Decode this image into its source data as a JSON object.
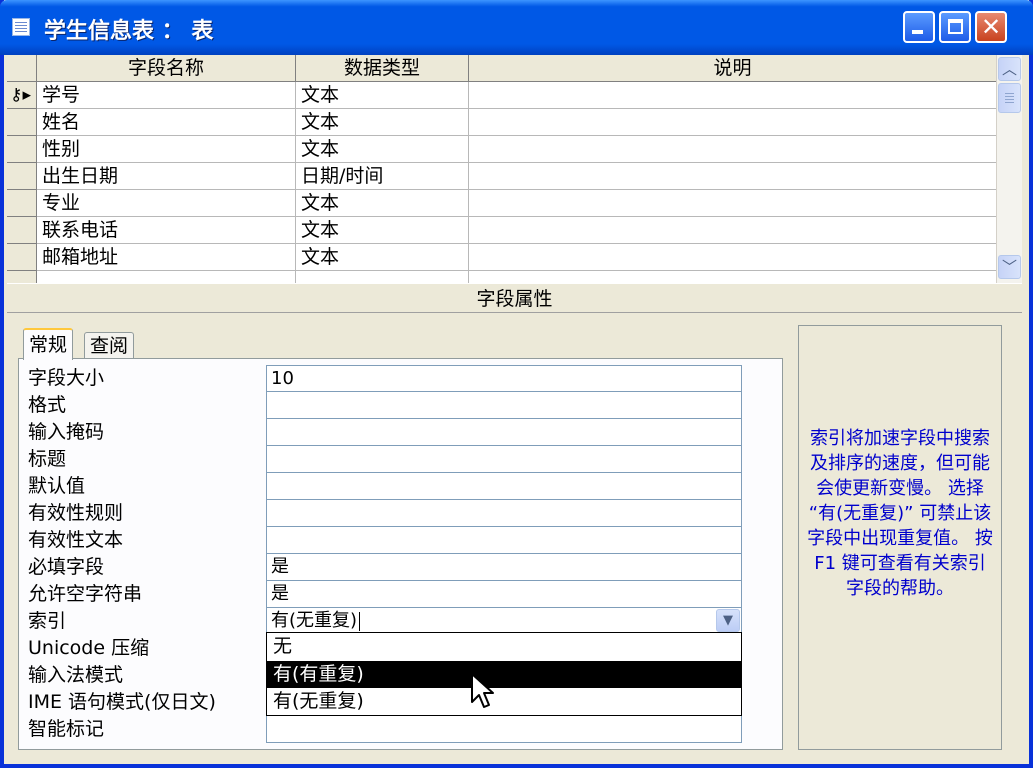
{
  "window": {
    "title": "学生信息表 ： 表"
  },
  "grid": {
    "headers": [
      "字段名称",
      "数据类型",
      "说明"
    ],
    "rows": [
      {
        "name": "学号",
        "type": "文本",
        "desc": ""
      },
      {
        "name": "姓名",
        "type": "文本",
        "desc": ""
      },
      {
        "name": "性别",
        "type": "文本",
        "desc": ""
      },
      {
        "name": "出生日期",
        "type": "日期/时间",
        "desc": ""
      },
      {
        "name": "专业",
        "type": "文本",
        "desc": ""
      },
      {
        "name": "联系电话",
        "type": "文本",
        "desc": ""
      },
      {
        "name": "邮箱地址",
        "type": "文本",
        "desc": ""
      }
    ]
  },
  "section_label": "字段属性",
  "tabs": {
    "general": "常规",
    "lookup": "查阅"
  },
  "properties": [
    {
      "label": "字段大小",
      "value": "10"
    },
    {
      "label": "格式",
      "value": ""
    },
    {
      "label": "输入掩码",
      "value": ""
    },
    {
      "label": "标题",
      "value": ""
    },
    {
      "label": "默认值",
      "value": ""
    },
    {
      "label": "有效性规则",
      "value": ""
    },
    {
      "label": "有效性文本",
      "value": ""
    },
    {
      "label": "必填字段",
      "value": "是"
    },
    {
      "label": "允许空字符串",
      "value": "是"
    },
    {
      "label": "索引",
      "value": "有(无重复)"
    },
    {
      "label": "Unicode 压缩",
      "value": ""
    },
    {
      "label": "输入法模式",
      "value": ""
    },
    {
      "label": "IME 语句模式(仅日文)",
      "value": ""
    },
    {
      "label": "智能标记",
      "value": ""
    }
  ],
  "dropdown": {
    "options": [
      "无",
      "有(有重复)",
      "有(无重复)"
    ],
    "highlighted_index": 1
  },
  "help_text": "索引将加速字段中搜索及排序的速度，但可能会使更新变慢。 选择 “有(无重复)” 可禁止该字段中出现重复值。 按 F1 键可查看有关索引字段的帮助。",
  "colors": {
    "title_bar": "#0058E6",
    "help_text": "#0000CC",
    "window_bg": "#ECE9D8"
  }
}
